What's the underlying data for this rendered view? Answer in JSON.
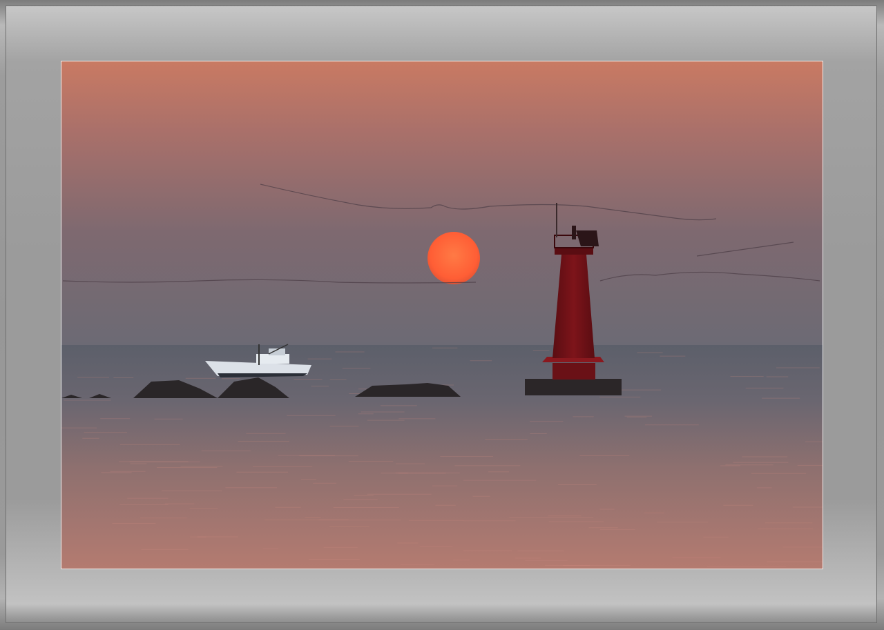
{
  "photo": {
    "subject": "",
    "colors": {
      "sky_top": "#c97a63",
      "sky_mid": "#8e6c6a",
      "sky_horizon": "#6f6871",
      "sun": "#ff6a3a",
      "sea_near": "#b07a72",
      "sea_far": "#5c5f6a",
      "lighthouse": "#7a1218",
      "rock": "#2a2628"
    }
  }
}
